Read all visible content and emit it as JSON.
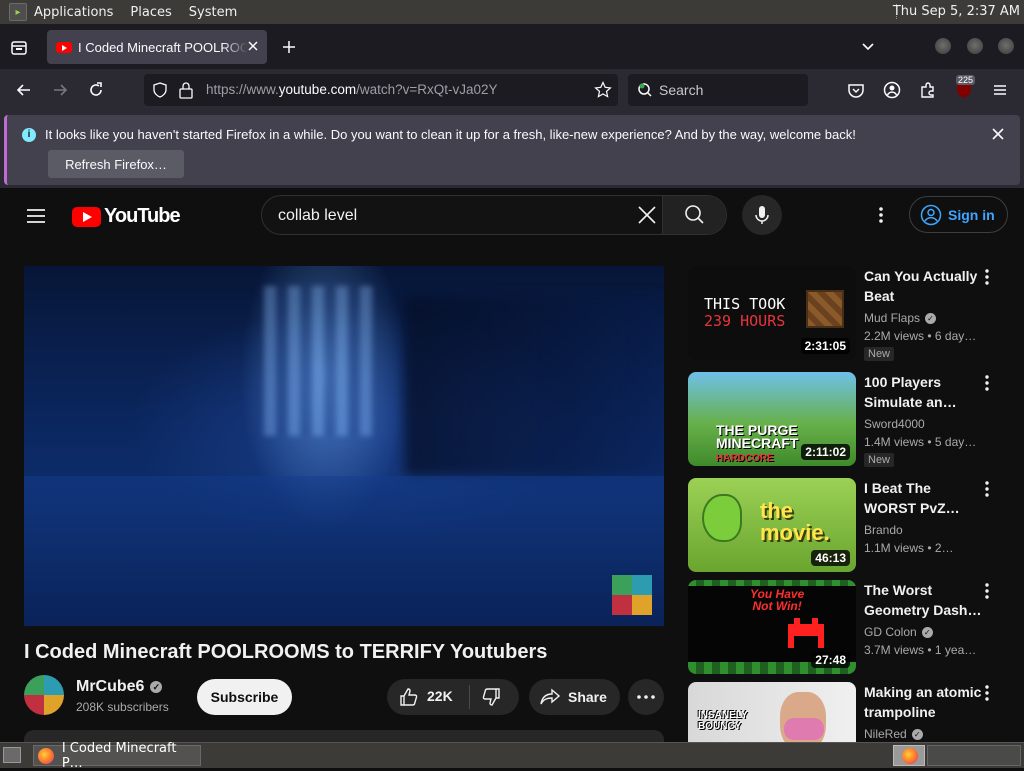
{
  "gnome_panel": {
    "menus": [
      "Applications",
      "Places",
      "System"
    ],
    "clock": "Thu Sep  5,  2:37 AM"
  },
  "browser": {
    "tab_title": "I Coded Minecraft POOLROOMS to TERRIFY Youtubers",
    "url_scheme": "https://www.",
    "url_host": "youtube.com",
    "url_path": "/watch?v=RxQt-vJa02Y",
    "search_placeholder": "Search",
    "extension_badge": "225"
  },
  "notification": {
    "message": "It looks like you haven't started Firefox in a while. Do you want to clean it up for a fresh, like-new experience? And by the way, welcome back!",
    "button": "Refresh Firefox…"
  },
  "youtube": {
    "logo_text": "YouTube",
    "search_query": "collab level",
    "sign_in": "Sign in",
    "video": {
      "title": "I Coded Minecraft POOLROOMS to TERRIFY Youtubers",
      "channel": "MrCube6",
      "subscribers": "208K subscribers",
      "subscribe": "Subscribe",
      "likes": "22K",
      "share": "Share"
    },
    "recommended": [
      {
        "title": "Can You Actually Beat Minecraft's…",
        "channel": "Mud Flaps",
        "verified": true,
        "meta": "2.2M views  • 6 day…",
        "duration": "2:31:05",
        "badge": "New",
        "thumb_text": [
          "THIS TOOK",
          "239 HOURS"
        ]
      },
      {
        "title": "100 Players Simulate an…",
        "channel": "Sword4000",
        "verified": false,
        "meta": "1.4M views  • 5 day…",
        "duration": "2:11:02",
        "badge": "New",
        "thumb_text": [
          "THE PURGE",
          "MINECRAFT",
          "HARDCORE"
        ]
      },
      {
        "title": "I Beat The WORST PvZ…",
        "channel": "Brando",
        "verified": false,
        "meta": "1.1M views  • 2…",
        "duration": "46:13",
        "badge": "",
        "thumb_text": [
          "the",
          "movie."
        ]
      },
      {
        "title": "The Worst Geometry Dash…",
        "channel": "GD Colon",
        "verified": true,
        "meta": "3.7M views  • 1 yea…",
        "duration": "27:48",
        "badge": "",
        "thumb_text": [
          "You Have",
          "Not Win!"
        ]
      },
      {
        "title": "Making an atomic trampoline",
        "channel": "NileRed",
        "verified": true,
        "meta": "",
        "duration": "",
        "badge": "",
        "thumb_text": [
          "INSANELY",
          "BOUNCY"
        ]
      }
    ]
  },
  "taskbar": {
    "task_title": "I Coded Minecraft P…"
  },
  "colors": {
    "yt_bg": "#0f0f0f",
    "yt_red": "#ff0000",
    "link_blue": "#3ea6ff",
    "firefox_toolbar": "#2b2a33"
  }
}
